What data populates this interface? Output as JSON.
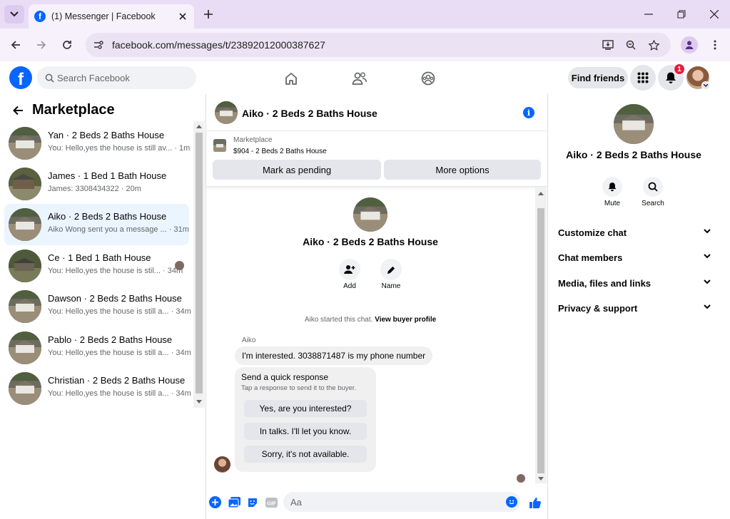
{
  "browser": {
    "tab_title": "(1) Messenger | Facebook",
    "url": "facebook.com/messages/t/23892012000387627"
  },
  "fb": {
    "search_placeholder": "Search Facebook",
    "find_friends": "Find friends",
    "notification_count": "1"
  },
  "sidebar": {
    "title": "Marketplace",
    "conversations": [
      {
        "name": "Yan · 2 Beds 2 Baths House",
        "preview": "You: Hello,yes the house is still av...",
        "time": "· 1m"
      },
      {
        "name": "James · 1 Bed 1 Bath House",
        "preview": "James: 3308434322",
        "time": "· 20m"
      },
      {
        "name": "Aiko · 2 Beds 2 Baths House",
        "preview": "Aiko Wong sent you a message ...",
        "time": "· 31m"
      },
      {
        "name": "Ce · 1 Bed 1 Bath House",
        "preview": "You: Hello,yes the house is stil...",
        "time": "· 34m"
      },
      {
        "name": "Dawson · 2 Beds 2 Baths House",
        "preview": "You: Hello,yes the house is still a...",
        "time": "· 34m"
      },
      {
        "name": "Pablo · 2 Beds 2 Baths House",
        "preview": "You: Hello,yes the house is still a...",
        "time": "· 34m"
      },
      {
        "name": "Christian · 2 Beds 2 Baths House",
        "preview": "You: Hello,yes the house is still a...",
        "time": "· 34m"
      }
    ]
  },
  "chat": {
    "title": "Aiko · 2 Beds 2 Baths House",
    "listing_label": "Marketplace",
    "listing_price": "$904 - 2 Beds 2 Baths House",
    "mark_pending": "Mark as pending",
    "more_options": "More options",
    "center_title": "Aiko · 2 Beds 2 Baths House",
    "add_label": "Add",
    "name_label": "Name",
    "started_text": "Aiko started this chat.",
    "view_profile": "View buyer profile",
    "sender": "Aiko",
    "message": "I'm interested. 3038871487 is my phone number",
    "quick_title": "Send a quick response",
    "quick_sub": "Tap a response to send it to the buyer.",
    "quick_options": [
      "Yes, are you interested?",
      "In talks. I'll let you know.",
      "Sorry, it's not available."
    ],
    "composer_placeholder": "Aa"
  },
  "details": {
    "title": "Aiko · 2 Beds 2 Baths House",
    "mute": "Mute",
    "search": "Search",
    "sections": [
      "Customize chat",
      "Chat members",
      "Media, files and links",
      "Privacy & support"
    ]
  },
  "colors": {
    "fb_blue": "#0866ff",
    "tab_bg": "#e9ddf6",
    "selected_row": "#ebf5ff"
  }
}
